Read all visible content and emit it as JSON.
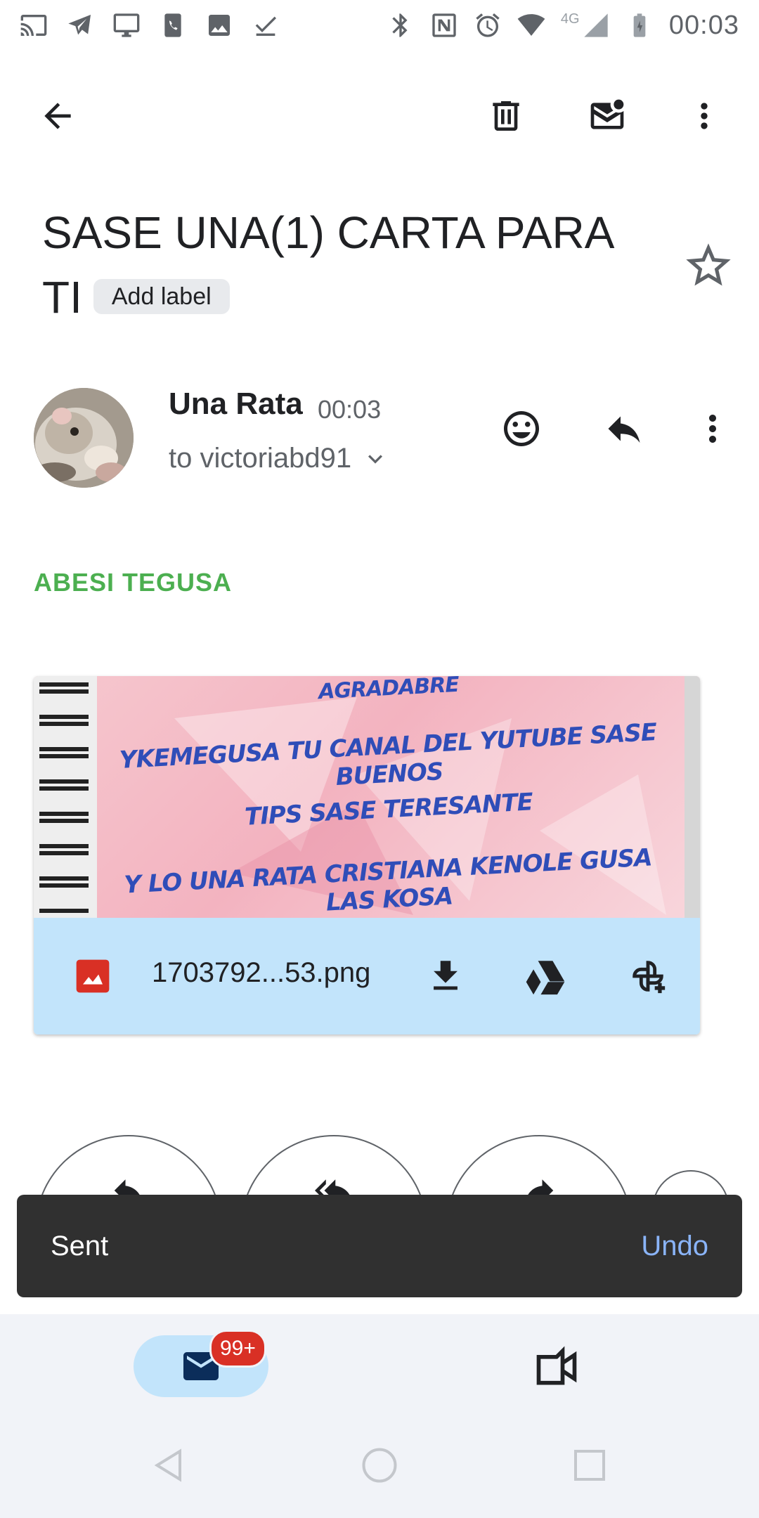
{
  "status_bar": {
    "time": "00:03",
    "network": "4G",
    "left_icons": [
      "cast-icon",
      "telegram-icon",
      "desktop-icon",
      "phone-icon",
      "image-icon",
      "task-check-icon"
    ],
    "right_icons": [
      "bluetooth-icon",
      "nfc-icon",
      "alarm-icon",
      "wifi-icon",
      "signal-icon",
      "battery-icon"
    ]
  },
  "toolbar": {
    "icons": [
      "back-arrow-icon",
      "delete-icon",
      "mark-unread-icon",
      "more-vert-icon"
    ]
  },
  "email": {
    "subject": "SASE UNA(1) CARTA PARA TI",
    "add_label": "Add label",
    "sender_name": "Una Rata",
    "time": "00:03",
    "recipient": "to victoriabd91",
    "greeting": "ABESI TEGUSA"
  },
  "attachment": {
    "preview_lines": [
      "AGRADABRE",
      "YKEMEGUSA TU CANAL DEL YUTUBE SASE BUENOS",
      "TIPS SASE TERESANTE",
      "Y LO UNA RATA CRISTIANA KENOLE GUSA LAS KOSA"
    ],
    "filename": "1703792...53.png",
    "icons": [
      "image-file-icon",
      "download-icon",
      "drive-icon",
      "photos-add-icon"
    ]
  },
  "snackbar": {
    "message": "Sent",
    "action": "Undo"
  },
  "bottom_nav": {
    "mail_badge": "99+",
    "items": [
      "mail-icon",
      "meet-icon"
    ]
  },
  "colors": {
    "greeting": "#4caf50",
    "attachment_bar": "#c2e4fb",
    "snackbar": "#303030",
    "undo": "#8ab4f8",
    "badge": "#d93025",
    "attachment_text": "#2f4db8"
  }
}
